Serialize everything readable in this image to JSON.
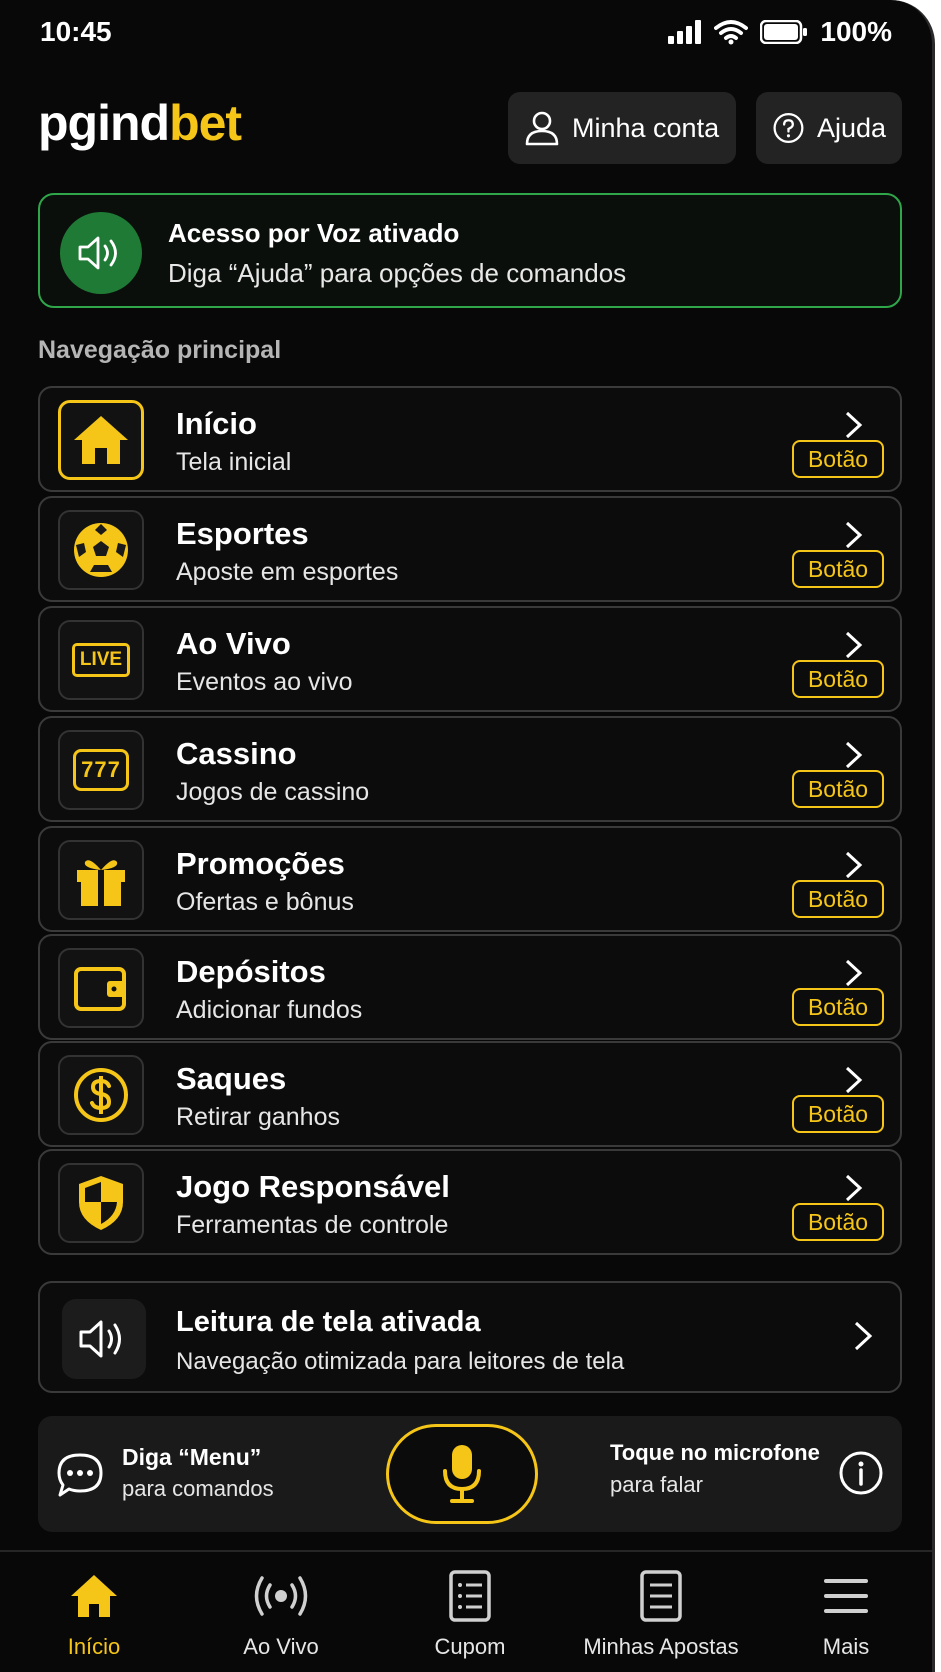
{
  "status_bar": {
    "time": "10:45",
    "battery": "100%"
  },
  "header": {
    "logo_part1": "pgind",
    "logo_part2": "bet",
    "account_label": "Minha conta",
    "help_label": "Ajuda"
  },
  "voice_banner": {
    "title": "Acesso por Voz ativado",
    "subtitle": "Diga “Ajuda” para opções de comandos"
  },
  "section_title": "Navegação principal",
  "nav_items": [
    {
      "title": "Início",
      "subtitle": "Tela inicial",
      "badge": "Botão",
      "icon": "home-icon"
    },
    {
      "title": "Esportes",
      "subtitle": "Aposte em esportes",
      "badge": "Botão",
      "icon": "soccer-ball-icon"
    },
    {
      "title": "Ao Vivo",
      "subtitle": "Eventos ao vivo",
      "badge": "Botão",
      "icon": "live-icon"
    },
    {
      "title": "Cassino",
      "subtitle": "Jogos de cassino",
      "badge": "Botão",
      "icon": "slot-machine-icon"
    },
    {
      "title": "Promoções",
      "subtitle": "Ofertas e bônus",
      "badge": "Botão",
      "icon": "gift-icon"
    },
    {
      "title": "Depósitos",
      "subtitle": "Adicionar fundos",
      "badge": "Botão",
      "icon": "wallet-icon"
    },
    {
      "title": "Saques",
      "subtitle": "Retirar ganhos",
      "badge": "Botão",
      "icon": "dollar-coin-icon"
    },
    {
      "title": "Jogo Responsável",
      "subtitle": "Ferramentas de controle",
      "badge": "Botão",
      "icon": "shield-icon"
    }
  ],
  "live_icon_text": "LIVE",
  "slot_icon_text": "777",
  "screen_reader": {
    "title": "Leitura de tela ativada",
    "subtitle": "Navegação otimizada para leitores de tela"
  },
  "command_bar": {
    "left_line1": "Diga “Menu”",
    "left_line2": "para comandos",
    "right_line1": "Toque no microfone",
    "right_line2": "para falar"
  },
  "tabbar": [
    {
      "label": "Início",
      "icon": "home-icon",
      "active": true
    },
    {
      "label": "Ao Vivo",
      "icon": "broadcast-icon",
      "active": false
    },
    {
      "label": "Cupom",
      "icon": "receipt-icon",
      "active": false
    },
    {
      "label": "Minhas Apostas",
      "icon": "document-icon",
      "active": false
    },
    {
      "label": "Mais",
      "icon": "menu-icon",
      "active": false
    }
  ],
  "colors": {
    "accent": "#f5c518",
    "success": "#2fa64a",
    "background": "#080808"
  }
}
